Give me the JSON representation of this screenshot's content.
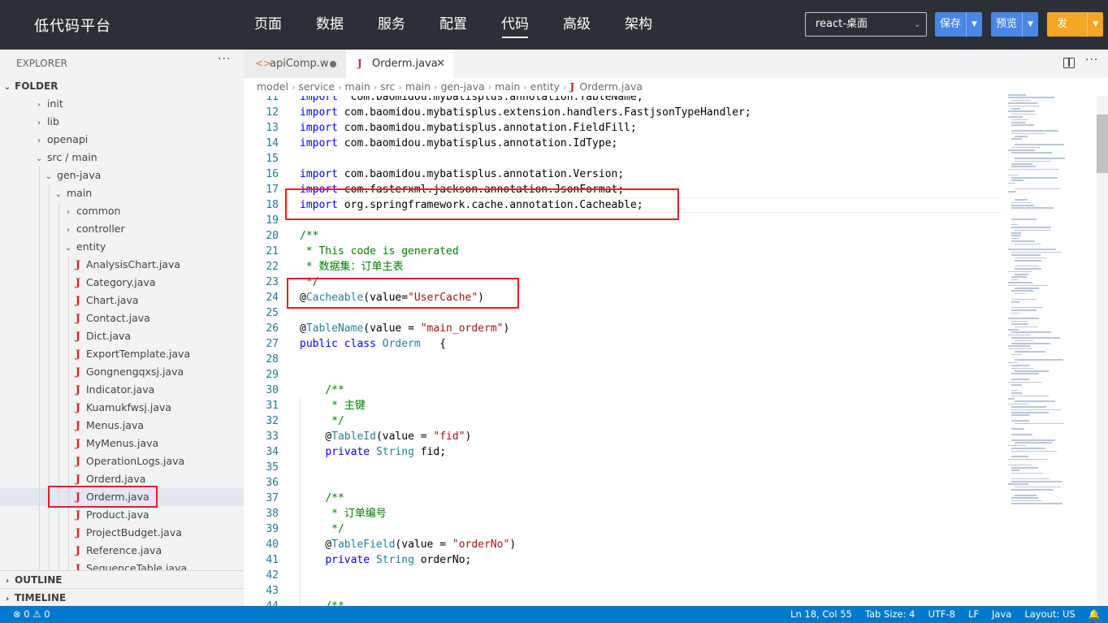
{
  "app": {
    "brand": "低代码平台",
    "nav": [
      "页面",
      "数据",
      "服务",
      "配置",
      "代码",
      "高级",
      "架构"
    ],
    "active_nav_index": 4,
    "platform_select": "react-桌面",
    "buttons": {
      "save": "保存",
      "preview": "预览",
      "publish": "发布"
    },
    "colors": {
      "topbar": "#2b3036",
      "primary_button": "#4a86e6",
      "publish_button": "#f5a623",
      "statusbar": "#007acc",
      "highlight": "#e02020"
    }
  },
  "sidebar": {
    "title": "EXPLORER",
    "more": "···",
    "folder": "FOLDER",
    "tree": [
      {
        "label": "init",
        "depth": 0,
        "kind": "folder",
        "open": false
      },
      {
        "label": "lib",
        "depth": 0,
        "kind": "folder",
        "open": false
      },
      {
        "label": "openapi",
        "depth": 0,
        "kind": "folder",
        "open": false
      },
      {
        "label": "src / main",
        "depth": 0,
        "kind": "folder",
        "open": true
      },
      {
        "label": "gen-java",
        "depth": 1,
        "kind": "folder",
        "open": true
      },
      {
        "label": "main",
        "depth": 2,
        "kind": "folder",
        "open": true
      },
      {
        "label": "common",
        "depth": 3,
        "kind": "folder",
        "open": false
      },
      {
        "label": "controller",
        "depth": 3,
        "kind": "folder",
        "open": false
      },
      {
        "label": "entity",
        "depth": 3,
        "kind": "folder",
        "open": true
      },
      {
        "label": "AnalysisChart.java",
        "depth": 4,
        "kind": "java"
      },
      {
        "label": "Category.java",
        "depth": 4,
        "kind": "java"
      },
      {
        "label": "Chart.java",
        "depth": 4,
        "kind": "java"
      },
      {
        "label": "Contact.java",
        "depth": 4,
        "kind": "java"
      },
      {
        "label": "Dict.java",
        "depth": 4,
        "kind": "java"
      },
      {
        "label": "ExportTemplate.java",
        "depth": 4,
        "kind": "java"
      },
      {
        "label": "Gongnengqxsj.java",
        "depth": 4,
        "kind": "java"
      },
      {
        "label": "Indicator.java",
        "depth": 4,
        "kind": "java"
      },
      {
        "label": "Kuamukfwsj.java",
        "depth": 4,
        "kind": "java"
      },
      {
        "label": "Menus.java",
        "depth": 4,
        "kind": "java"
      },
      {
        "label": "MyMenus.java",
        "depth": 4,
        "kind": "java"
      },
      {
        "label": "OperationLogs.java",
        "depth": 4,
        "kind": "java"
      },
      {
        "label": "Orderd.java",
        "depth": 4,
        "kind": "java"
      },
      {
        "label": "Orderm.java",
        "depth": 4,
        "kind": "java",
        "selected": true
      },
      {
        "label": "Product.java",
        "depth": 4,
        "kind": "java"
      },
      {
        "label": "ProjectBudget.java",
        "depth": 4,
        "kind": "java"
      },
      {
        "label": "Reference.java",
        "depth": 4,
        "kind": "java"
      },
      {
        "label": "SequenceTable.java",
        "depth": 4,
        "kind": "java"
      }
    ],
    "outline": "OUTLINE",
    "timeline": "TIMELINE"
  },
  "editor": {
    "tabs": [
      {
        "label": "apiComp.w",
        "icon": "code-icon",
        "modified": true
      },
      {
        "label": "Orderm.java",
        "icon": "java-icon",
        "active": true
      }
    ],
    "breadcrumb": [
      "model",
      "service",
      "main",
      "src",
      "main",
      "gen-java",
      "main",
      "entity",
      "Orderm.java"
    ],
    "current_line": 18,
    "lines": [
      {
        "n": "11",
        "code": [
          [
            "kw",
            "import"
          ],
          [
            "",
            "  com.baomidou.mybatisplus.annotation.TableName;"
          ]
        ]
      },
      {
        "n": "12",
        "code": [
          [
            "kw",
            "import"
          ],
          [
            "",
            " com.baomidou.mybatisplus.extension.handlers.FastjsonTypeHandler;"
          ]
        ]
      },
      {
        "n": "13",
        "code": [
          [
            "kw",
            "import"
          ],
          [
            "",
            " com.baomidou.mybatisplus.annotation.FieldFill;"
          ]
        ]
      },
      {
        "n": "14",
        "code": [
          [
            "kw",
            "import"
          ],
          [
            "",
            " com.baomidou.mybatisplus.annotation.IdType;"
          ]
        ]
      },
      {
        "n": "15",
        "code": []
      },
      {
        "n": "16",
        "code": [
          [
            "kw",
            "import"
          ],
          [
            "",
            " com.baomidou.mybatisplus.annotation.Version;"
          ]
        ]
      },
      {
        "n": "17",
        "code": [
          [
            "kw",
            "import"
          ],
          [
            "",
            " com.fasterxml.jackson.annotation.JsonFormat;"
          ]
        ]
      },
      {
        "n": "18",
        "code": [
          [
            "kw",
            "import"
          ],
          [
            "",
            " org.springframework.cache.annotation.Cacheable;"
          ]
        ]
      },
      {
        "n": "19",
        "code": []
      },
      {
        "n": "20",
        "code": [
          [
            "cm",
            "/**"
          ]
        ]
      },
      {
        "n": "21",
        "code": [
          [
            "cm",
            " * This code is generated"
          ]
        ]
      },
      {
        "n": "22",
        "code": [
          [
            "cm",
            " * 数据集：订单主表"
          ]
        ]
      },
      {
        "n": "23",
        "code": [
          [
            "cm",
            " */"
          ]
        ]
      },
      {
        "n": "24",
        "code": [
          [
            "",
            "@"
          ],
          [
            "ann",
            "Cacheable"
          ],
          [
            "",
            "(value="
          ],
          [
            "str",
            "\"UserCache\""
          ],
          [
            "",
            ")"
          ]
        ]
      },
      {
        "n": "25",
        "code": []
      },
      {
        "n": "26",
        "code": [
          [
            "",
            "@"
          ],
          [
            "ann",
            "TableName"
          ],
          [
            "",
            "(value = "
          ],
          [
            "str",
            "\"main_orderm\""
          ],
          [
            "",
            ")"
          ]
        ]
      },
      {
        "n": "27",
        "code": [
          [
            "kw",
            "public class"
          ],
          [
            "",
            " "
          ],
          [
            "ty",
            "Orderm"
          ],
          [
            "",
            "   {"
          ]
        ]
      },
      {
        "n": "28",
        "code": []
      },
      {
        "n": "29",
        "code": []
      },
      {
        "n": "30",
        "code": [
          [
            "",
            "    "
          ],
          [
            "cm",
            "/**"
          ]
        ]
      },
      {
        "n": "31",
        "code": [
          [
            "",
            "    "
          ],
          [
            "cm",
            " * 主键"
          ]
        ]
      },
      {
        "n": "32",
        "code": [
          [
            "",
            "    "
          ],
          [
            "cm",
            " */"
          ]
        ]
      },
      {
        "n": "33",
        "code": [
          [
            "",
            "    @"
          ],
          [
            "ann",
            "TableId"
          ],
          [
            "",
            "(value = "
          ],
          [
            "str",
            "\"fid\""
          ],
          [
            "",
            ")"
          ]
        ]
      },
      {
        "n": "34",
        "code": [
          [
            "",
            "    "
          ],
          [
            "kw",
            "private"
          ],
          [
            "",
            " "
          ],
          [
            "ty",
            "String"
          ],
          [
            "",
            " fid;"
          ]
        ]
      },
      {
        "n": "35",
        "code": []
      },
      {
        "n": "36",
        "code": []
      },
      {
        "n": "37",
        "code": [
          [
            "",
            "    "
          ],
          [
            "cm",
            "/**"
          ]
        ]
      },
      {
        "n": "38",
        "code": [
          [
            "",
            "    "
          ],
          [
            "cm",
            " * 订单编号"
          ]
        ]
      },
      {
        "n": "39",
        "code": [
          [
            "",
            "    "
          ],
          [
            "cm",
            " */"
          ]
        ]
      },
      {
        "n": "40",
        "code": [
          [
            "",
            "    @"
          ],
          [
            "ann",
            "TableField"
          ],
          [
            "",
            "(value = "
          ],
          [
            "str",
            "\"orderNo\""
          ],
          [
            "",
            ")"
          ]
        ]
      },
      {
        "n": "41",
        "code": [
          [
            "",
            "    "
          ],
          [
            "kw",
            "private"
          ],
          [
            "",
            " "
          ],
          [
            "ty",
            "String"
          ],
          [
            "",
            " orderNo;"
          ]
        ]
      },
      {
        "n": "42",
        "code": []
      },
      {
        "n": "43",
        "code": []
      },
      {
        "n": "44",
        "code": [
          [
            "",
            "    "
          ],
          [
            "cm",
            "/**"
          ]
        ]
      }
    ]
  },
  "statusbar": {
    "errors": "0",
    "warnings": "0",
    "position": "Ln 18, Col 55",
    "tab_size": "Tab Size: 4",
    "encoding": "UTF-8",
    "eol": "LF",
    "language": "Java",
    "layout": "Layout: US"
  }
}
